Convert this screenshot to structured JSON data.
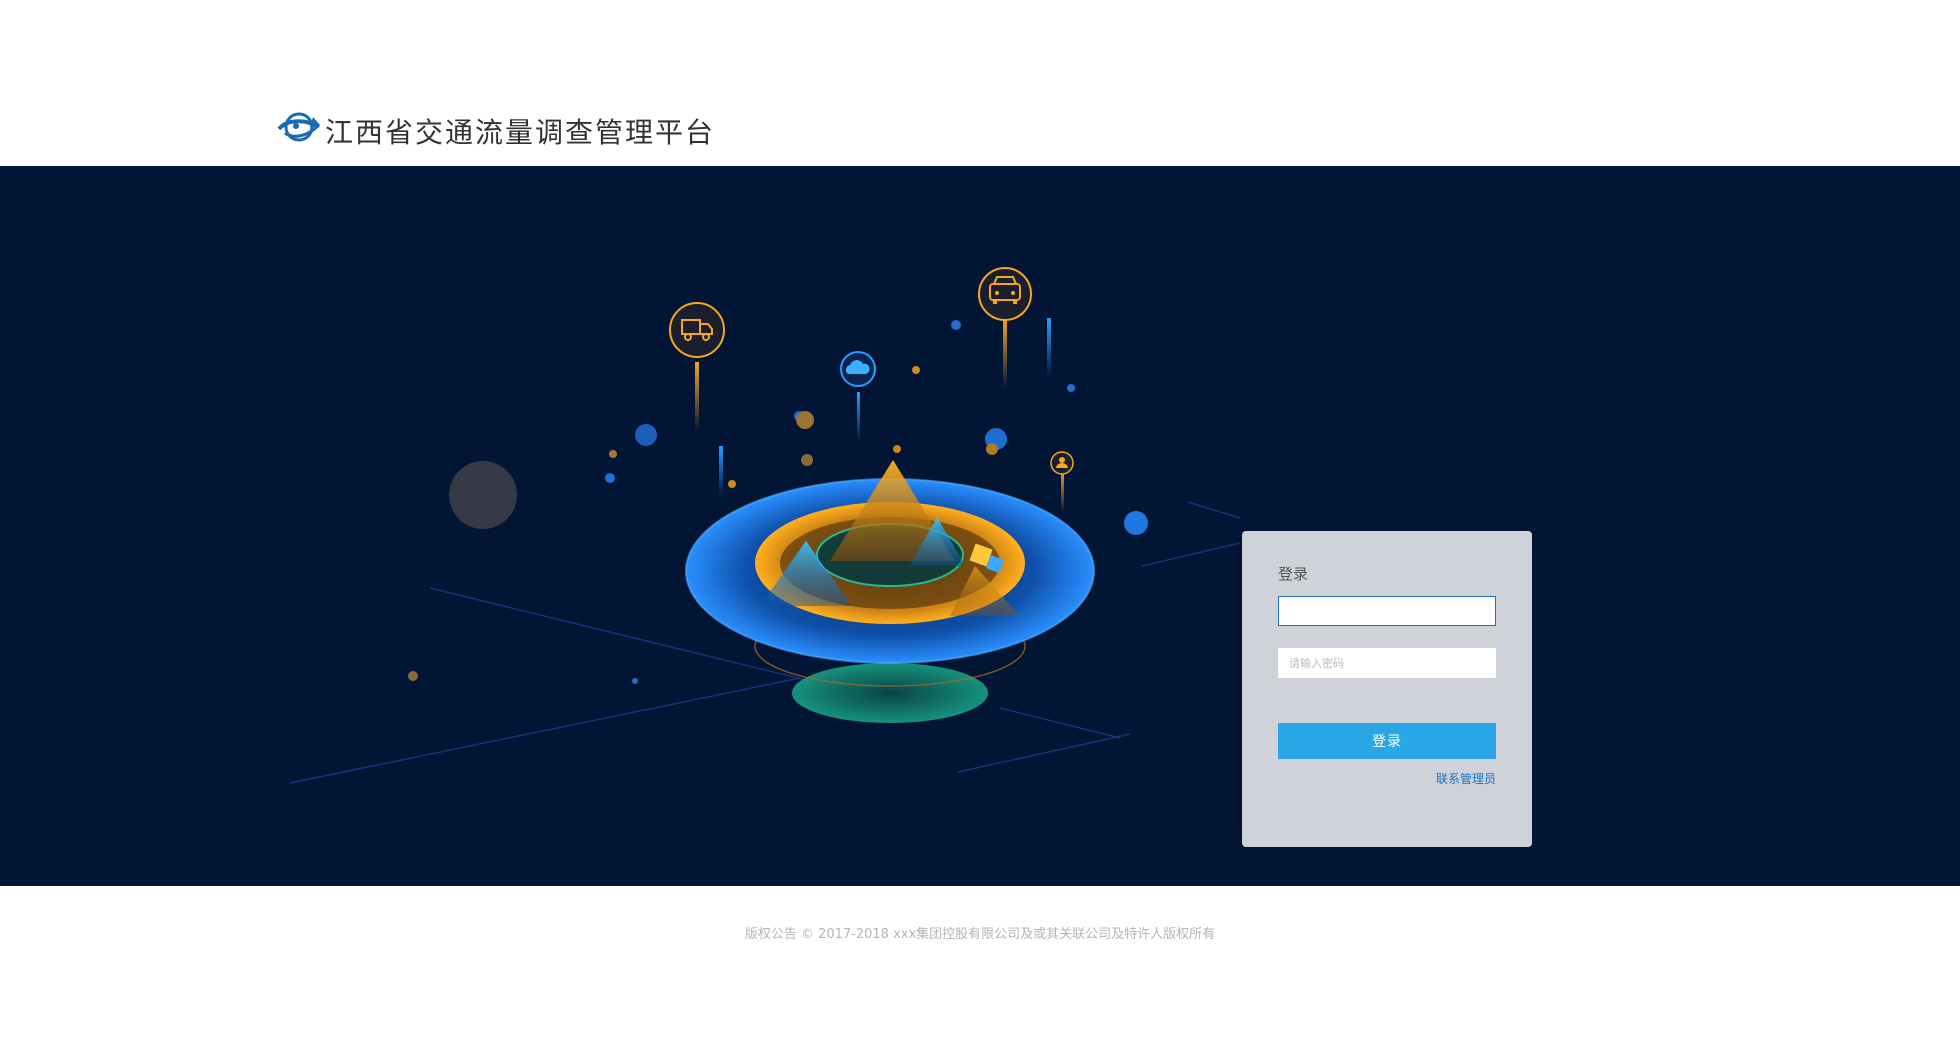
{
  "header": {
    "title": "江西省交通流量调查管理平台",
    "logo_icon": "globe-arrow-logo-icon"
  },
  "banner": {
    "background": "#031535",
    "icons": [
      "truck-icon",
      "cloud-icon",
      "car-icon",
      "user-icon"
    ]
  },
  "login": {
    "title": "登录",
    "username_value": "",
    "password_placeholder": "请输入密码",
    "submit_label": "登录",
    "contact_label": "联系管理员",
    "button_color": "#29a6e6"
  },
  "footer": {
    "copyright": "版权公告 © 2017-2018 xxx集团控股有限公司及或其关联公司及特许人版权所有"
  }
}
